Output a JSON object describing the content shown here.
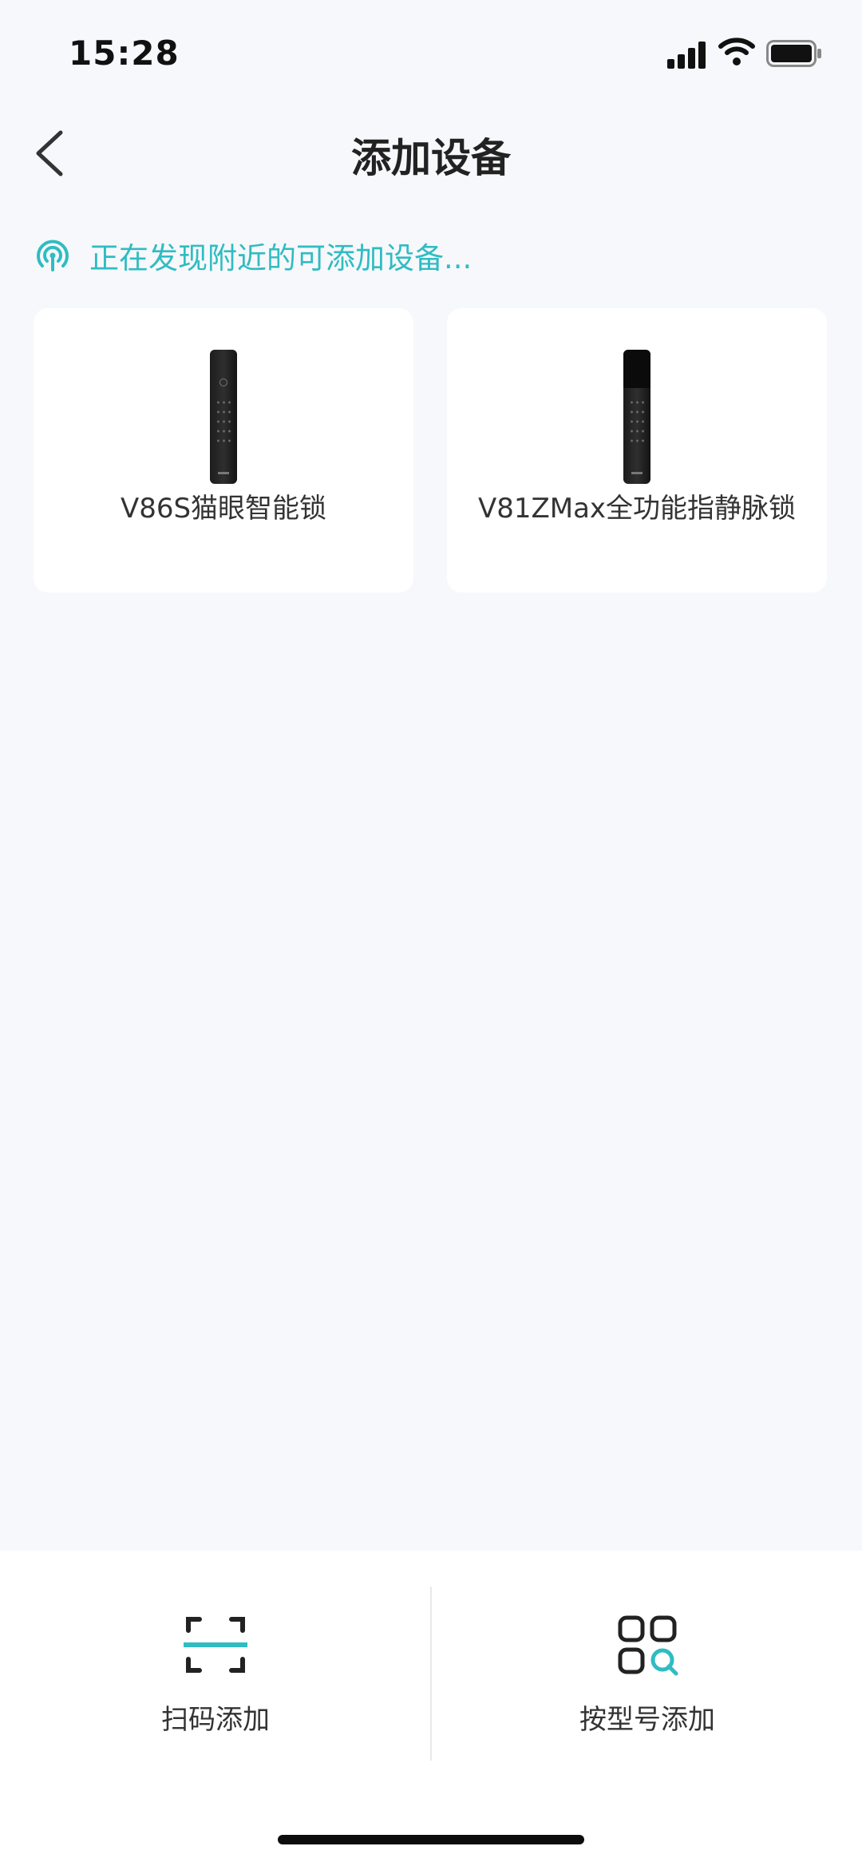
{
  "status_bar": {
    "time": "15:28",
    "icons": [
      "cellular-signal-icon",
      "wifi-icon",
      "battery-icon"
    ]
  },
  "nav": {
    "title": "添加设备",
    "back_icon": "chevron-left-icon"
  },
  "scan": {
    "text": "正在发现附近的可添加设备...",
    "icon": "radar-scan-icon",
    "color": "#2fbcc3"
  },
  "devices": [
    {
      "name": "V86S猫眼智能锁",
      "image": "smart-lock-image"
    },
    {
      "name": "V81ZMax全功能指静脉锁",
      "image": "smart-lock-image"
    }
  ],
  "actions": [
    {
      "label": "扫码添加",
      "icon": "scan-code-icon"
    },
    {
      "label": "按型号添加",
      "icon": "model-search-icon"
    }
  ],
  "colors": {
    "accent": "#2fbcc3",
    "background": "#f7f8fb",
    "card": "#ffffff"
  }
}
